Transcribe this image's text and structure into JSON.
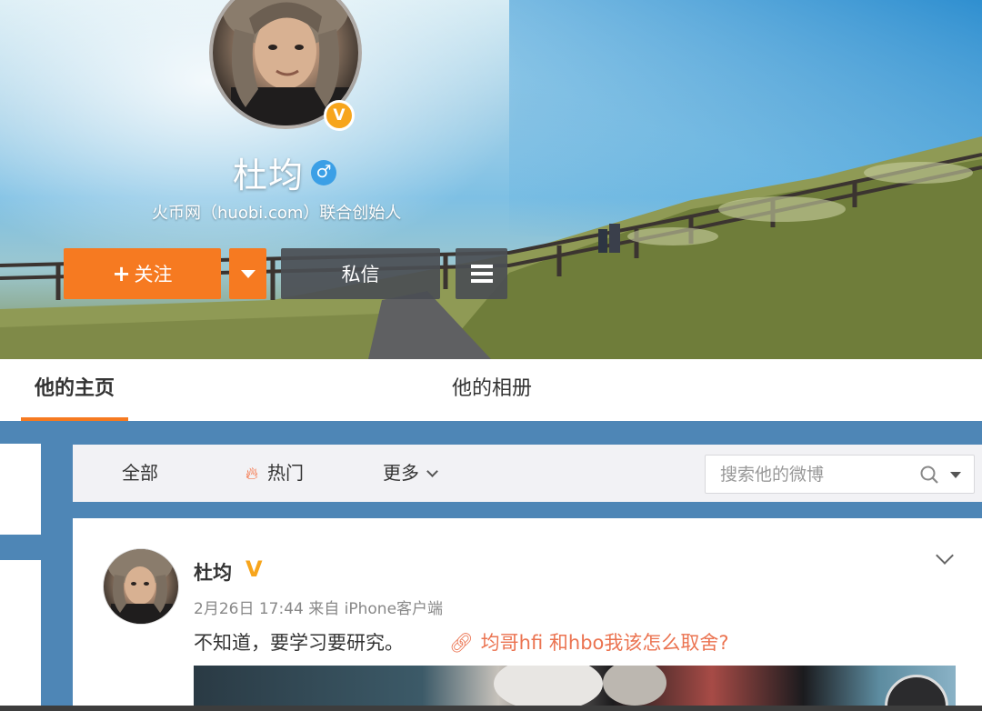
{
  "profile": {
    "name": "杜均",
    "verified_badge": "V",
    "gender_symbol": "♂",
    "description": "火币网（huobi.com）联合创始人"
  },
  "actions": {
    "follow_plus": "+",
    "follow_label": "关注",
    "message_label": "私信"
  },
  "tabs": [
    {
      "label": "他的主页",
      "active": true
    },
    {
      "label": "他的相册",
      "active": false
    }
  ],
  "filters": {
    "all": "全部",
    "hot": "热门",
    "more": "更多"
  },
  "search": {
    "placeholder": "搜索他的微博"
  },
  "post": {
    "author": "杜均",
    "vip_mark": "V",
    "meta": "2月26日 17:44 来自 iPhone客户端",
    "text": "不知道，要学习要研究。",
    "link_text": "均哥hfi 和hbo我该怎么取舍?"
  },
  "colors": {
    "accent": "#f67a21",
    "link": "#eb7350",
    "badge": "#f7a51c",
    "page_bg": "#4e86b6"
  }
}
